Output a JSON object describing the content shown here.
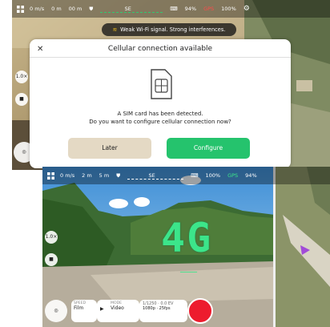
{
  "top": {
    "status": {
      "alt": "0 m/s",
      "height": "0 m",
      "dist": "00 m",
      "compass": "SE",
      "remote_battery": "94%",
      "gps": "GPS",
      "drone_battery": "100%",
      "colors": {
        "gps": "#ff4b4b",
        "compass_bar": "#32c870"
      }
    },
    "banner": "Weak Wi-Fi signal. Strong interferences.",
    "zoom": "1.0×",
    "dialog": {
      "title": "Cellular connection available",
      "line1": "A SIM card has been detected.",
      "line2": "Do you want to configure cellular connection now?",
      "later": "Later",
      "configure": "Configure",
      "colors": {
        "configure": "#25c36d",
        "later": "#e4d9c4"
      }
    }
  },
  "bottom": {
    "status": {
      "alt": "0 m/s",
      "height": "2 m",
      "dist": "5 m",
      "compass": "SE",
      "remote_battery": "100%",
      "gps": "GPS",
      "drone_battery": "94%",
      "colors": {
        "gps": "#3ce58a"
      }
    },
    "network": "4G",
    "zoom": "1.0×",
    "controls": {
      "speed_label": "SPEED",
      "speed_value": "Film",
      "mode_label": "MODE",
      "mode_value": "Video",
      "exposure": "1/1250 · 0.0 EV",
      "resolution": "1080p · 25fps"
    }
  }
}
